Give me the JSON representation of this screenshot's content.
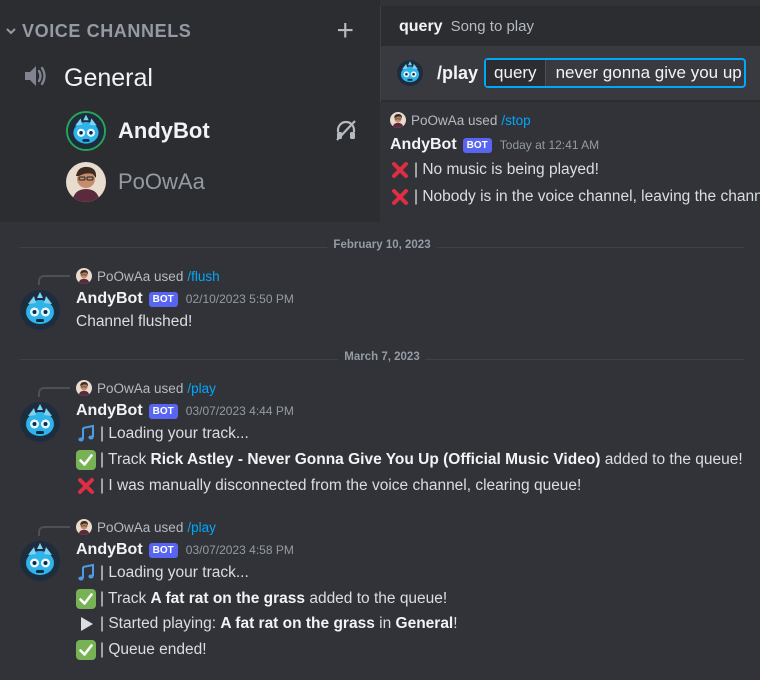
{
  "voice": {
    "section_title": "VOICE CHANNELS",
    "channel_name": "General",
    "users": [
      {
        "name": "AndyBot",
        "deafened": true
      },
      {
        "name": "PoOwAa",
        "deafened": false
      }
    ]
  },
  "command": {
    "hint_option": "query",
    "hint_desc": "Song to play",
    "slash": "/play",
    "field_label": "query",
    "field_value": "never gonna give you up"
  },
  "top_message": {
    "reply_user": "PoOwAa",
    "reply_used": "used",
    "reply_cmd": "/stop",
    "author": "AndyBot",
    "badge": "BOT",
    "timestamp": "Today at 12:41 AM",
    "lines": [
      "| No music is being played!",
      "| Nobody is in the voice channel, leaving the channel."
    ]
  },
  "dividers": [
    "February 10, 2023",
    "March 7, 2023"
  ],
  "messages": [
    {
      "reply_user": "PoOwAa",
      "reply_used": "used",
      "reply_cmd": "/flush",
      "author": "AndyBot",
      "badge": "BOT",
      "timestamp": "02/10/2023 5:50 PM",
      "text": "Channel flushed!"
    },
    {
      "reply_user": "PoOwAa",
      "reply_used": "used",
      "reply_cmd": "/play",
      "author": "AndyBot",
      "badge": "BOT",
      "timestamp": "03/07/2023 4:44 PM",
      "l1": "| Loading your track...",
      "l2_pre": "| Track ",
      "l2_bold": "Rick Astley - Never Gonna Give You Up (Official Music Video)",
      "l2_post": " added to the queue!",
      "l3": "| I was manually disconnected from the voice channel, clearing queue!"
    },
    {
      "reply_user": "PoOwAa",
      "reply_used": "used",
      "reply_cmd": "/play",
      "author": "AndyBot",
      "badge": "BOT",
      "timestamp": "03/07/2023 4:58 PM",
      "l1": "| Loading your track...",
      "l2_pre": "| Track ",
      "l2_bold": "A fat rat on the grass",
      "l2_post": " added to the queue!",
      "l3_pre": "| Started playing: ",
      "l3_bold": "A fat rat on the grass",
      "l3_mid": " in ",
      "l3_bold2": "General",
      "l3_post": "!",
      "l4": "| Queue ended!"
    }
  ],
  "colors": {
    "accent": "#5865f2",
    "link": "#00a8fc",
    "check": "#77b255",
    "cross": "#dd2e44"
  }
}
